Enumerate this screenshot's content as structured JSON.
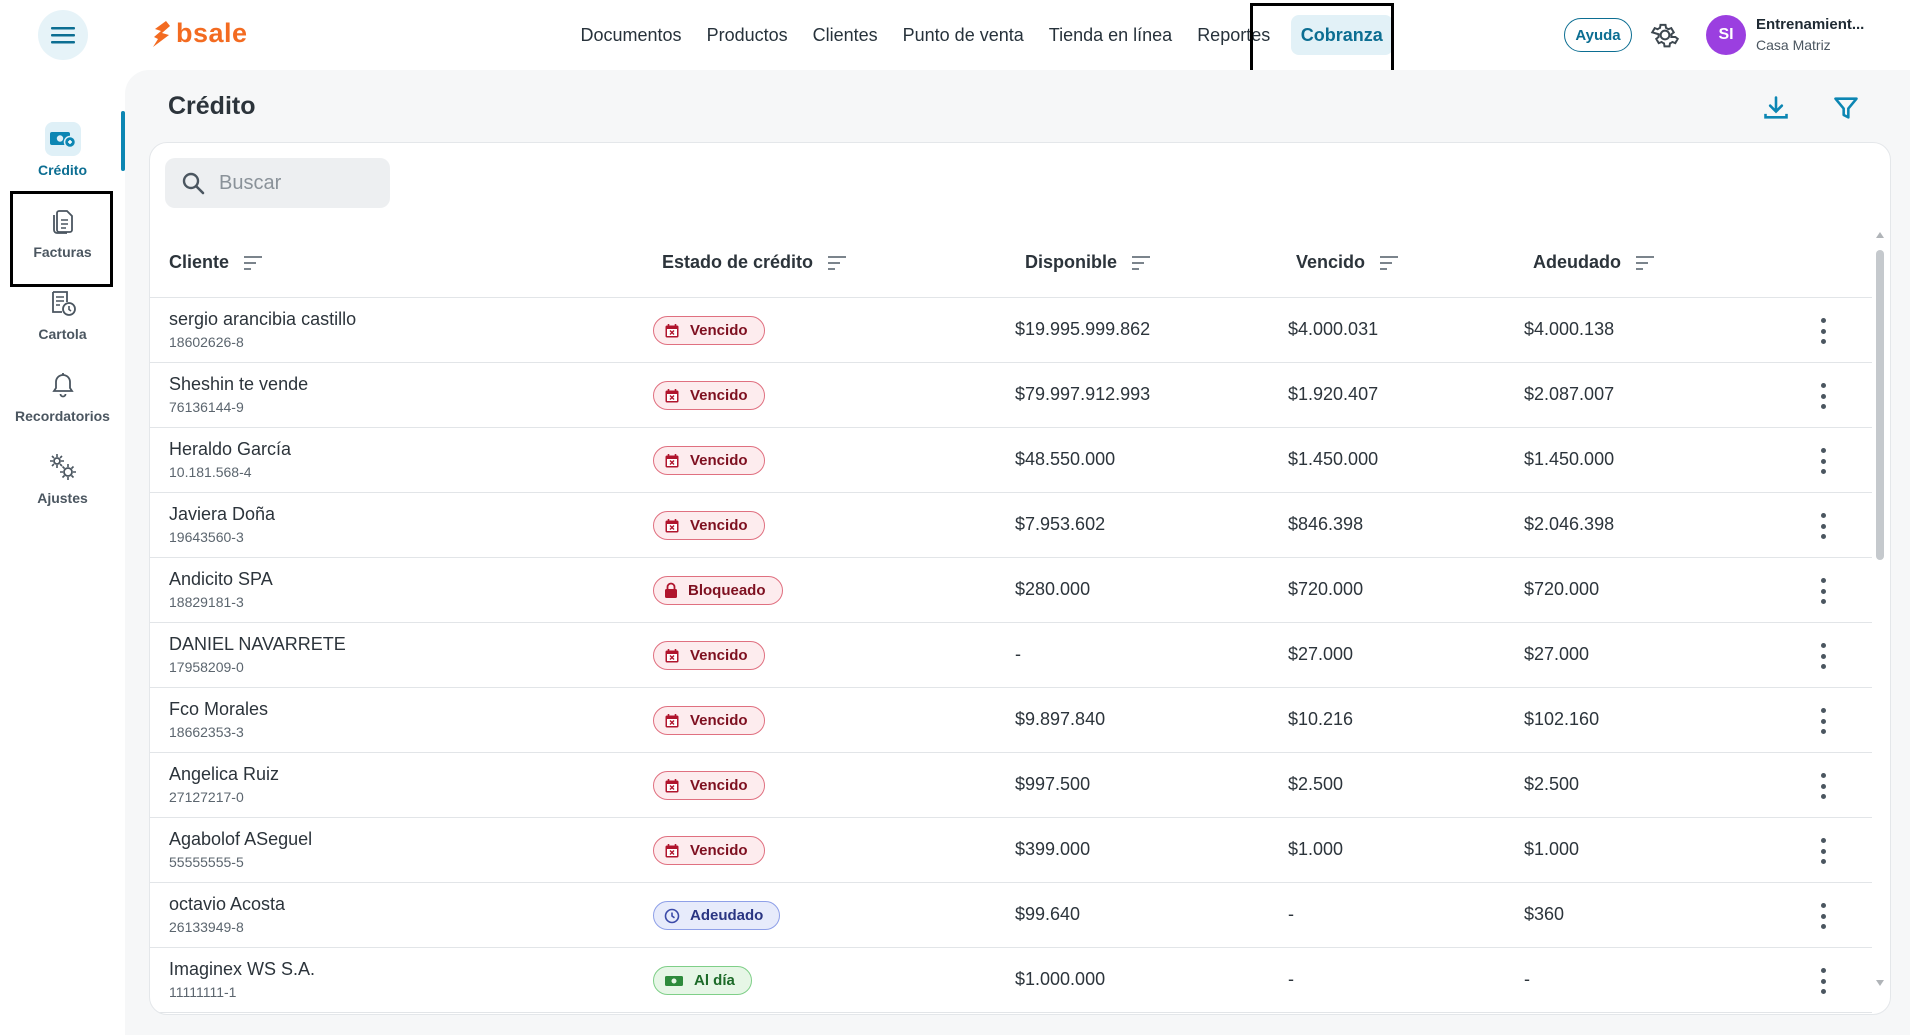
{
  "app": {
    "logo_text": "bsale",
    "logo_color": "#f36b21",
    "accent": "#0c6e92"
  },
  "nav": [
    {
      "label": "Documentos"
    },
    {
      "label": "Productos"
    },
    {
      "label": "Clientes"
    },
    {
      "label": "Punto de venta"
    },
    {
      "label": "Tienda en línea"
    },
    {
      "label": "Reportes"
    },
    {
      "label": "Cobranza",
      "active": true
    }
  ],
  "header": {
    "help_label": "Ayuda",
    "avatar_initials": "SI",
    "user_name": "Entrenamient...",
    "user_branch": "Casa Matriz"
  },
  "sidebar": [
    {
      "label": "Crédito",
      "icon": "money-icon",
      "active": true
    },
    {
      "label": "Facturas",
      "icon": "document-icon"
    },
    {
      "label": "Cartola",
      "icon": "statement-clock-icon"
    },
    {
      "label": "Recordatorios",
      "icon": "bell-icon"
    },
    {
      "label": "Ajustes",
      "icon": "gears-icon"
    }
  ],
  "page": {
    "title": "Crédito",
    "search_placeholder": "Buscar"
  },
  "table": {
    "columns": [
      {
        "label": "Cliente"
      },
      {
        "label": "Estado de crédito"
      },
      {
        "label": "Disponible"
      },
      {
        "label": "Vencido"
      },
      {
        "label": "Adeudado"
      }
    ],
    "rows": [
      {
        "name": "sergio arancibia castillo",
        "rut": "18602626-8",
        "status": "Vencido",
        "status_type": "vencido",
        "disponible": "$19.995.999.862",
        "vencido": "$4.000.031",
        "adeudado": "$4.000.138"
      },
      {
        "name": "Sheshin te vende",
        "rut": "76136144-9",
        "status": "Vencido",
        "status_type": "vencido",
        "disponible": "$79.997.912.993",
        "vencido": "$1.920.407",
        "adeudado": "$2.087.007"
      },
      {
        "name": "Heraldo García",
        "rut": "10.181.568-4",
        "status": "Vencido",
        "status_type": "vencido",
        "disponible": "$48.550.000",
        "vencido": "$1.450.000",
        "adeudado": "$1.450.000"
      },
      {
        "name": "Javiera Doña",
        "rut": "19643560-3",
        "status": "Vencido",
        "status_type": "vencido",
        "disponible": "$7.953.602",
        "vencido": "$846.398",
        "adeudado": "$2.046.398"
      },
      {
        "name": "Andicito SPA",
        "rut": "18829181-3",
        "status": "Bloqueado",
        "status_type": "bloqueado",
        "disponible": "$280.000",
        "vencido": "$720.000",
        "adeudado": "$720.000"
      },
      {
        "name": "DANIEL NAVARRETE",
        "rut": "17958209-0",
        "status": "Vencido",
        "status_type": "vencido",
        "disponible": "-",
        "vencido": "$27.000",
        "adeudado": "$27.000"
      },
      {
        "name": "Fco Morales",
        "rut": "18662353-3",
        "status": "Vencido",
        "status_type": "vencido",
        "disponible": "$9.897.840",
        "vencido": "$10.216",
        "adeudado": "$102.160"
      },
      {
        "name": "Angelica Ruiz",
        "rut": "27127217-0",
        "status": "Vencido",
        "status_type": "vencido",
        "disponible": "$997.500",
        "vencido": "$2.500",
        "adeudado": "$2.500"
      },
      {
        "name": "Agabolof ASeguel",
        "rut": "55555555-5",
        "status": "Vencido",
        "status_type": "vencido",
        "disponible": "$399.000",
        "vencido": "$1.000",
        "adeudado": "$1.000"
      },
      {
        "name": "octavio Acosta",
        "rut": "26133949-8",
        "status": "Adeudado",
        "status_type": "adeudado",
        "disponible": "$99.640",
        "vencido": "-",
        "adeudado": "$360"
      },
      {
        "name": "Imaginex WS S.A.",
        "rut": "11111111-1",
        "status": "Al día",
        "status_type": "aldia",
        "disponible": "$1.000.000",
        "vencido": "-",
        "adeudado": "-"
      }
    ]
  }
}
